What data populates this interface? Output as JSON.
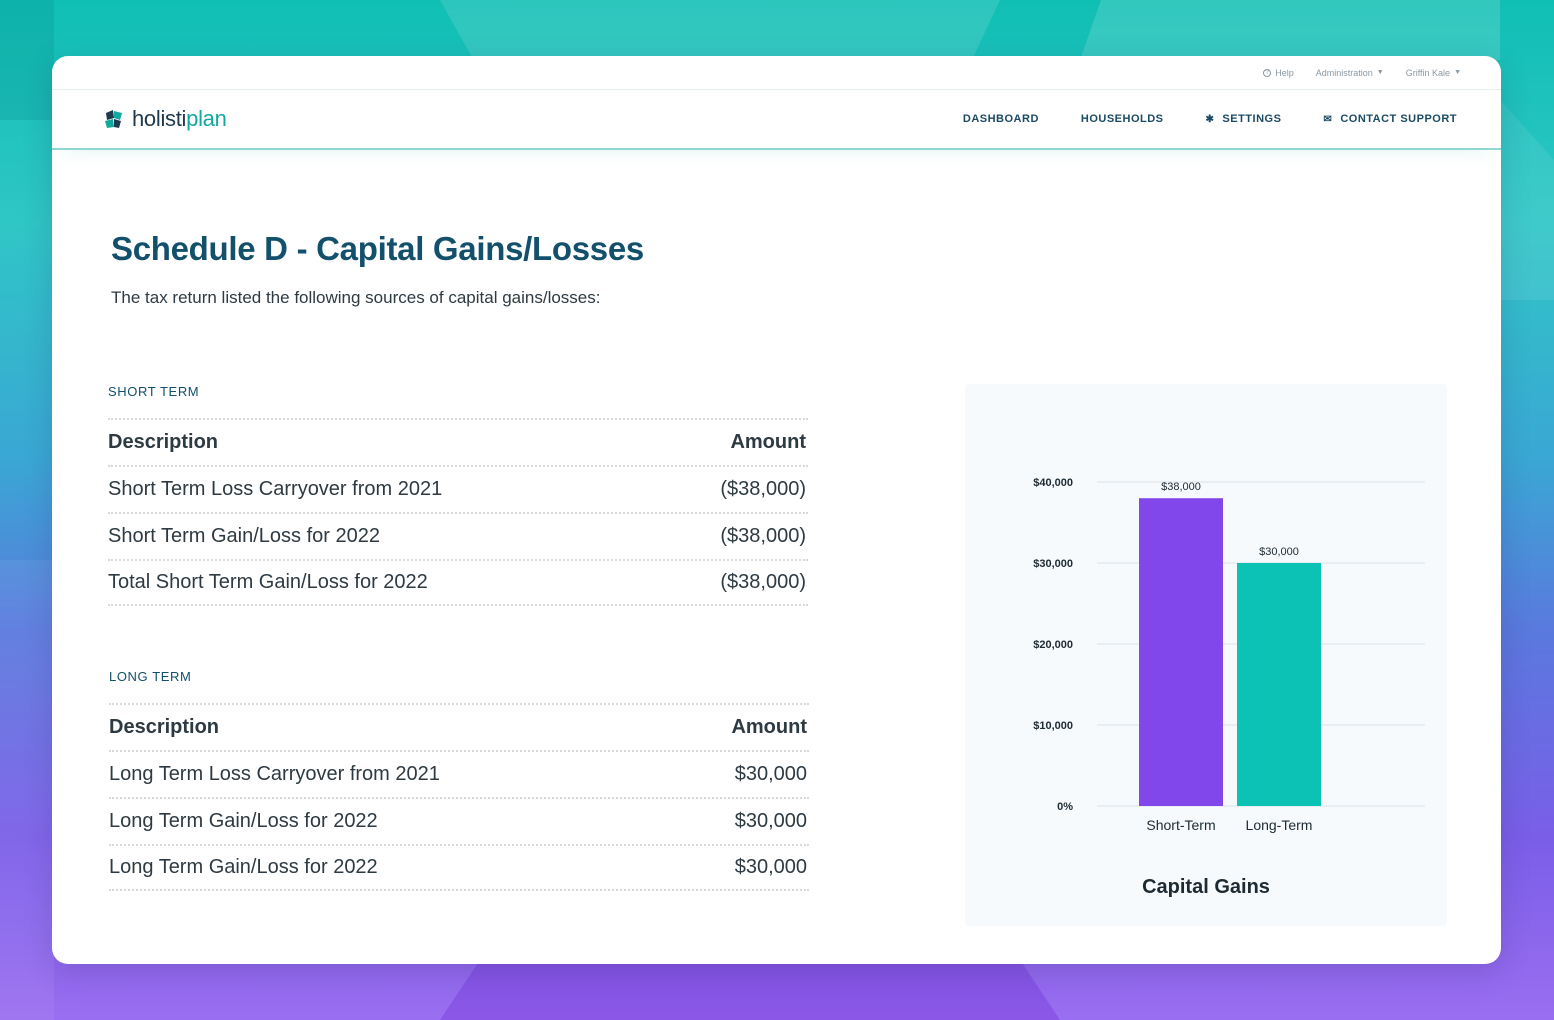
{
  "utility_bar": {
    "help_label": "Help",
    "admin_label": "Administration",
    "user_label": "Griffin Kale"
  },
  "brand": {
    "logo_text_main": "holisti",
    "logo_text_accent": "plan"
  },
  "nav": {
    "items": [
      {
        "label": "DASHBOARD",
        "icon": ""
      },
      {
        "label": "HOUSEHOLDS",
        "icon": ""
      },
      {
        "label": "SETTINGS",
        "icon": "gear-icon"
      },
      {
        "label": "CONTACT SUPPORT",
        "icon": "envelope-icon"
      }
    ]
  },
  "page": {
    "title": "Schedule D - Capital Gains/Losses",
    "subtitle": "The tax return listed the following sources of capital gains/losses:"
  },
  "short_term": {
    "section_label": "SHORT TERM",
    "header_description": "Description",
    "header_amount": "Amount",
    "rows": [
      {
        "description": "Short Term Loss Carryover from 2021",
        "amount": "($38,000)"
      },
      {
        "description": "Short Term Gain/Loss for 2022",
        "amount": "($38,000)"
      },
      {
        "description": "Total Short Term Gain/Loss for 2022",
        "amount": "($38,000)"
      }
    ]
  },
  "long_term": {
    "section_label": "LONG TERM",
    "header_description": "Description",
    "header_amount": "Amount",
    "rows": [
      {
        "description": "Long Term Loss Carryover from 2021",
        "amount": "$30,000"
      },
      {
        "description": "Long Term Gain/Loss for 2022",
        "amount": "$30,000"
      },
      {
        "description": "Long Term Gain/Loss for 2022",
        "amount": "$30,000"
      }
    ]
  },
  "chart_data": {
    "type": "bar",
    "title": "Capital Gains",
    "categories": [
      "Short-Term",
      "Long-Term"
    ],
    "values": [
      38000,
      30000
    ],
    "data_labels": [
      "$38,000",
      "$30,000"
    ],
    "colors": [
      "#8147ea",
      "#0cc2b5"
    ],
    "ylim": [
      0,
      40000
    ],
    "yticks": [
      0,
      10000,
      20000,
      30000,
      40000
    ],
    "ytick_labels": [
      "0%",
      "$10,000",
      "$20,000",
      "$30,000",
      "$40,000"
    ],
    "xlabel": "",
    "ylabel": "",
    "grid": true
  },
  "colors": {
    "brand_teal": "#13a89e",
    "title_blue": "#12506b",
    "nav_blue": "#1b4a63"
  }
}
